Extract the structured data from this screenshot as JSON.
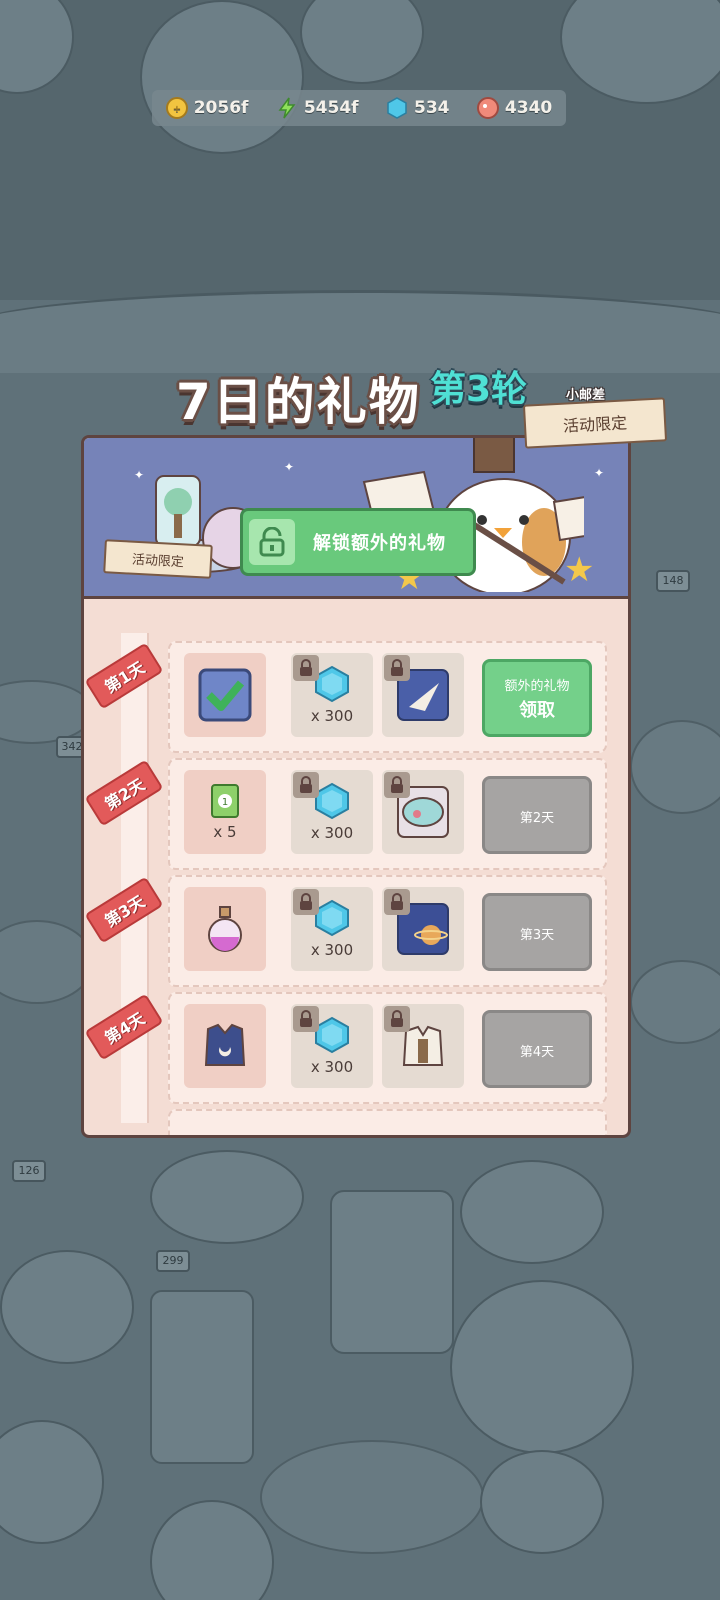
{
  "resources": [
    {
      "icon": "coin-icon",
      "value": "2056f"
    },
    {
      "icon": "lightning-icon",
      "value": "5454f"
    },
    {
      "icon": "blue-gem-icon",
      "value": "534"
    },
    {
      "icon": "fish-icon",
      "value": "4340"
    }
  ],
  "title": {
    "main": "7日的礼物",
    "round": "第3轮",
    "postman": "小邮差",
    "limited_tag": "活动限定"
  },
  "banner": {
    "unlock_label": "解锁额外的礼物",
    "limited_tag": "活动限定"
  },
  "days": [
    {
      "badge": "第1天",
      "free_icon": "checkmark-icon",
      "free_qty": "",
      "gem_qty": "x 300",
      "item_icon": "paper-plane-icon",
      "claim_sub": "额外的礼物",
      "claim_main": "领取",
      "claimable": true
    },
    {
      "badge": "第2天",
      "free_icon": "ticket-icon",
      "free_qty": "x 5",
      "gem_qty": "x 300",
      "item_icon": "bowl-icon",
      "claim_sub": "",
      "claim_main": "第2天",
      "claimable": false
    },
    {
      "badge": "第3天",
      "free_icon": "potion-icon",
      "free_qty": "",
      "gem_qty": "x 300",
      "item_icon": "planet-icon",
      "claim_sub": "",
      "claim_main": "第3天",
      "claimable": false
    },
    {
      "badge": "第4天",
      "free_icon": "vest-icon",
      "free_qty": "",
      "gem_qty": "x 300",
      "item_icon": "bag-icon",
      "claim_sub": "",
      "claim_main": "第4天",
      "claimable": false
    }
  ],
  "colors": {
    "accent_green": "#69c97c",
    "day_badge": "#e25a5a",
    "gem": "#4fc7e8"
  }
}
